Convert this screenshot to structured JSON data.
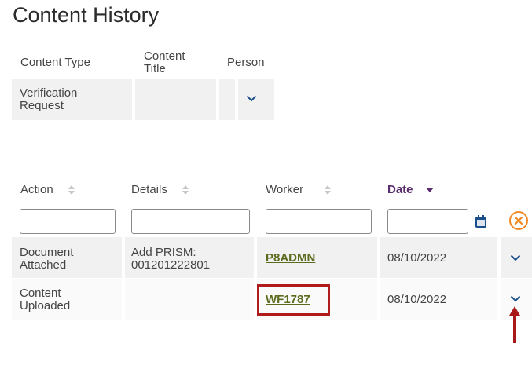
{
  "page": {
    "title": "Content History"
  },
  "content_table": {
    "headers": {
      "type": "Content Type",
      "title": "Content Title",
      "person": "Person"
    },
    "row": {
      "type": "Verification Request",
      "title": "",
      "person": ""
    }
  },
  "history_table": {
    "headers": {
      "action": "Action",
      "details": "Details",
      "worker": "Worker",
      "date": "Date"
    },
    "filters": {
      "action": "",
      "details": "",
      "worker": "",
      "date": ""
    },
    "rows": [
      {
        "action": "Document Attached",
        "details": "Add PRISM: 001201222801",
        "worker": "P8ADMN",
        "date": "08/10/2022"
      },
      {
        "action": "Content Uploaded",
        "details": "",
        "worker": "WF1787",
        "date": "08/10/2022"
      }
    ]
  },
  "colors": {
    "accent": "#1a4f8b",
    "link": "#5a6b1e",
    "highlight": "#b01c1c",
    "clear": "#f08a24",
    "date_header": "#5a2d6e"
  },
  "icons": [
    "chevron-down-icon",
    "calendar-icon",
    "clear-filter-icon",
    "sort-icon",
    "sort-desc-icon",
    "arrow-up-icon"
  ]
}
